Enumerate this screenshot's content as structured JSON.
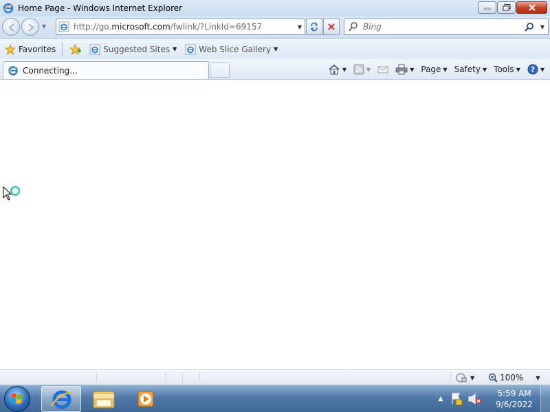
{
  "window": {
    "title": "Home Page - Windows Internet Explorer"
  },
  "navigation": {
    "address_url_prefix": "http://go.",
    "address_url_domain": "microsoft.com",
    "address_url_suffix": "/fwlink/?LinkId=69157",
    "search_placeholder": "Bing"
  },
  "favorites_bar": {
    "favorites_label": "Favorites",
    "items": [
      {
        "label": "Suggested Sites"
      },
      {
        "label": "Web Slice Gallery"
      }
    ]
  },
  "tabs": [
    {
      "label": "Connecting...",
      "active": true
    }
  ],
  "commands": {
    "page_label": "Page",
    "safety_label": "Safety",
    "tools_label": "Tools"
  },
  "status_bar": {
    "zoom": "100%"
  },
  "taskbar": {
    "time": "5:59 AM",
    "date": "9/6/2022"
  },
  "colors": {
    "accent": "#2c6bb7",
    "close_red": "#c7452b"
  }
}
